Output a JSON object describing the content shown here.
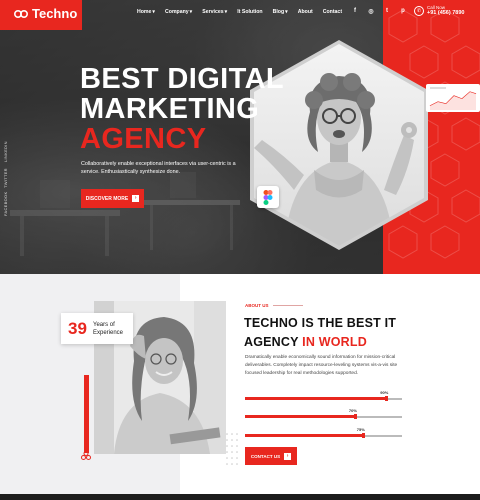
{
  "brand": {
    "name": "Techno",
    "accent": "#e8271f",
    "dark": "#2b2b2b"
  },
  "nav": {
    "items": [
      {
        "label": "Home",
        "has_dropdown": true
      },
      {
        "label": "Company",
        "has_dropdown": true
      },
      {
        "label": "Services",
        "has_dropdown": true
      },
      {
        "label": "It Solution",
        "has_dropdown": false
      },
      {
        "label": "Blog",
        "has_dropdown": true
      },
      {
        "label": "About",
        "has_dropdown": false
      },
      {
        "label": "Contact",
        "has_dropdown": false
      }
    ],
    "dropdown_glyph": "▾"
  },
  "social": [
    {
      "icon": "facebook-icon",
      "glyph": "f"
    },
    {
      "icon": "instagram-icon",
      "glyph": "◎"
    },
    {
      "icon": "twitter-icon",
      "glyph": "t"
    },
    {
      "icon": "pinterest-icon",
      "glyph": "p"
    }
  ],
  "call": {
    "label": "Call Now",
    "number": "+91 (456) 7890",
    "icon": "phone-icon"
  },
  "side_links": [
    "LINKEDIN",
    "TWITTER",
    "FACEBOOK"
  ],
  "hero": {
    "title_line1": "BEST DIGITAL",
    "title_line2": "MARKETING",
    "title_line3": "AGENCY",
    "description": "Collaboratively enable exceptional interfaces via user-centric is a service. Enthusiastically synthesize done.",
    "button_label": "DISCOVER MORE",
    "button_icon": "arrow-right-icon"
  },
  "about": {
    "kicker": "ABOUT US",
    "title_line1": "TECHNO IS THE BEST IT",
    "title_line2_plain": "AGENCY ",
    "title_line2_red": "IN WORLD",
    "description": "Dramatically enable economically sound information for mission-critical deliverables. Completely impact resource-leveling systems vis-a-vis site focused leadership for real methodologies supported.",
    "years_number": "39",
    "years_label_1": "Years of",
    "years_label_2": "Experience",
    "skills": [
      {
        "pct_label": "90%",
        "value": 0.9
      },
      {
        "pct_label": "70%",
        "value": 0.7
      },
      {
        "pct_label": "75%",
        "value": 0.75
      }
    ],
    "button_label": "CONTACT US",
    "button_icon": "arrow-right-icon"
  }
}
